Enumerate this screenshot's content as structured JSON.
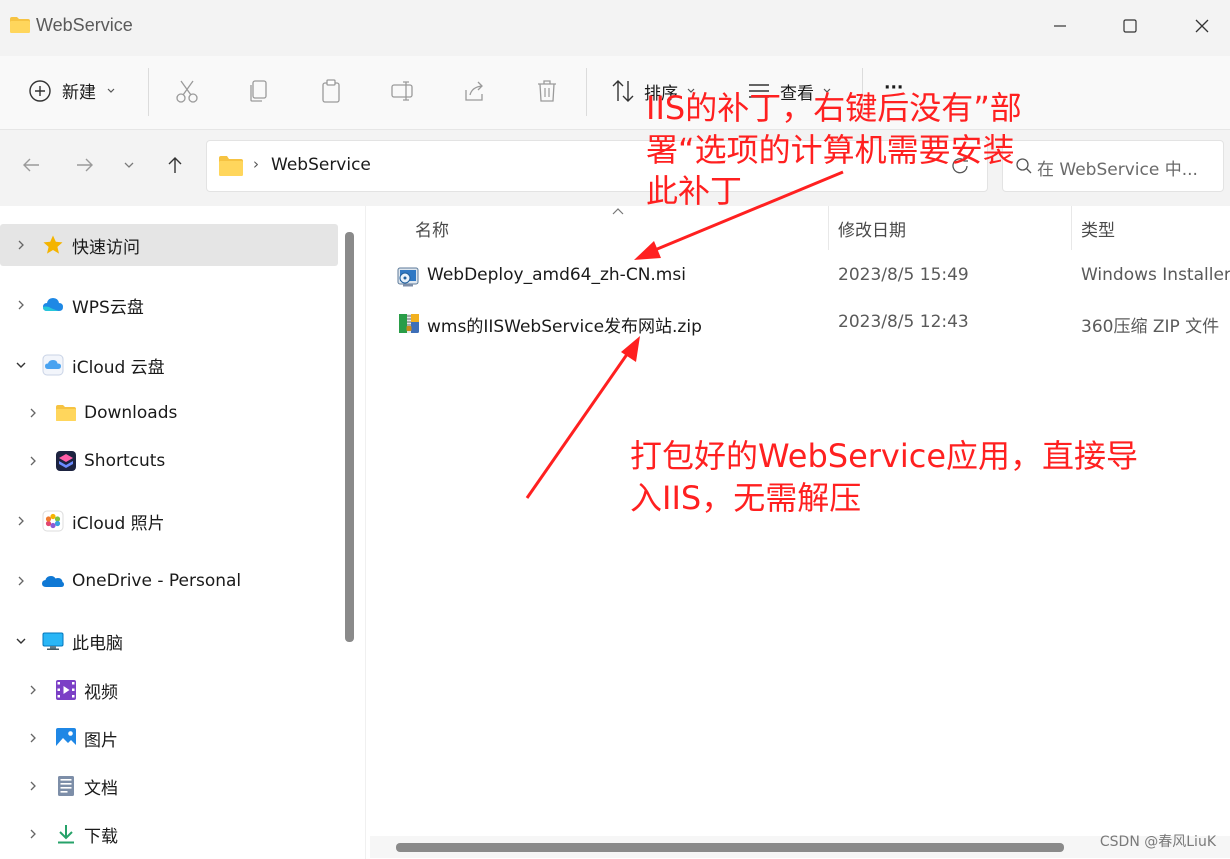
{
  "window": {
    "title": "WebService"
  },
  "toolbar": {
    "new_label": "新建",
    "sort_label": "排序",
    "view_label": "查看",
    "more_label": "···"
  },
  "address": {
    "path": [
      "WebService"
    ],
    "search_placeholder": "在 WebService 中..."
  },
  "sidebar": {
    "items": [
      {
        "label": "快速访问",
        "icon": "star-icon"
      },
      {
        "label": "WPS云盘",
        "icon": "cloud-icon"
      },
      {
        "label": "iCloud 云盘",
        "icon": "icloud-icon"
      },
      {
        "label": "Downloads",
        "icon": "folder-icon"
      },
      {
        "label": "Shortcuts",
        "icon": "shortcuts-icon"
      },
      {
        "label": "iCloud 照片",
        "icon": "photos-icon"
      },
      {
        "label": "OneDrive - Personal",
        "icon": "onedrive-icon"
      },
      {
        "label": "此电脑",
        "icon": "computer-icon"
      },
      {
        "label": "视频",
        "icon": "video-icon"
      },
      {
        "label": "图片",
        "icon": "pictures-icon"
      },
      {
        "label": "文档",
        "icon": "documents-icon"
      },
      {
        "label": "下载",
        "icon": "download-icon"
      }
    ]
  },
  "columns": {
    "name": "名称",
    "modified": "修改日期",
    "type": "类型"
  },
  "files": [
    {
      "name": "WebDeploy_amd64_zh-CN.msi",
      "modified": "2023/8/5 15:49",
      "type": "Windows Installer"
    },
    {
      "name": "wms的IISWebService发布网站.zip",
      "modified": "2023/8/5 12:43",
      "type": "360压缩 ZIP 文件"
    }
  ],
  "annotations": {
    "top_line1": "IIS的补丁，右键后没有”部",
    "top_line2": "署“选项的计算机需要安装",
    "top_line3": "此补丁",
    "bottom_line1": "打包好的WebService应用，直接导",
    "bottom_line2": "入IIS，无需解压"
  },
  "watermark": "CSDN @春风LiuK",
  "colors": {
    "annotation": "#ff2020",
    "folder": "#f6c342",
    "accent": "#0067c0"
  }
}
